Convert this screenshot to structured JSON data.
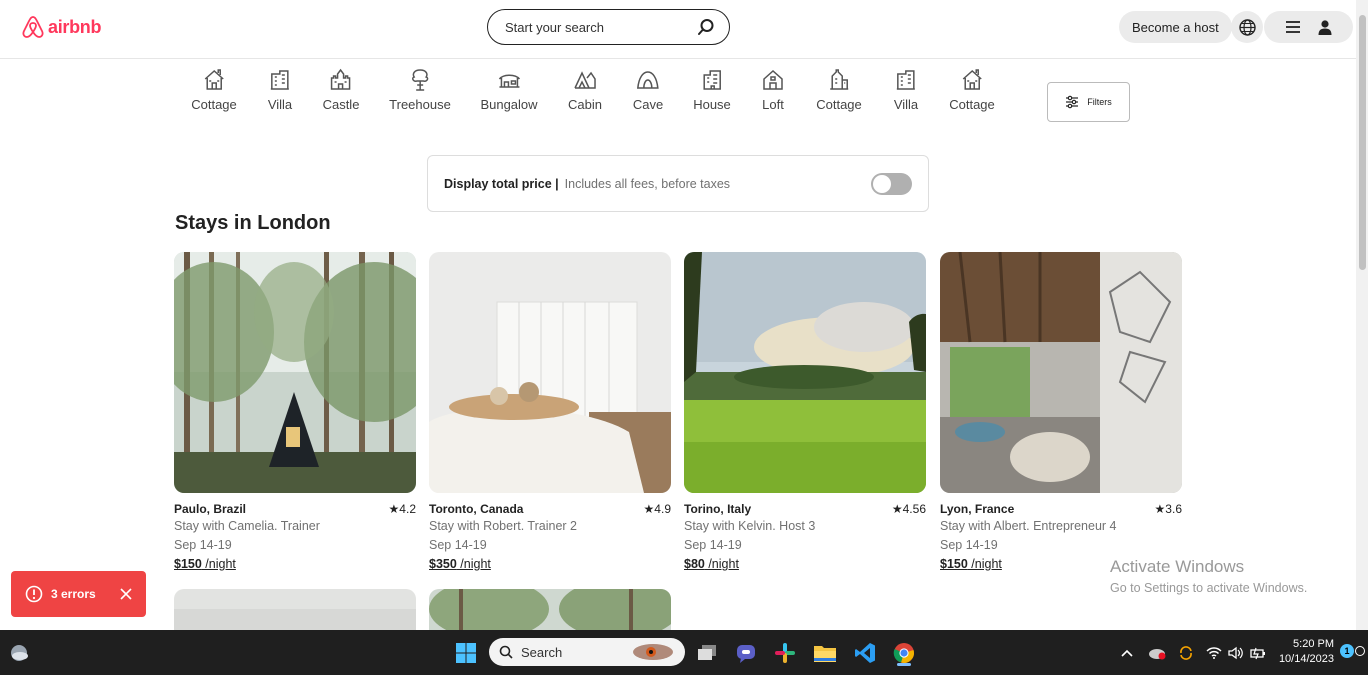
{
  "header": {
    "logo_text": "airbnb",
    "search_placeholder": "Start your search",
    "host_label": "Become a host"
  },
  "categories": [
    {
      "label": "Cottage",
      "icon": "cottage-icon"
    },
    {
      "label": "Villa",
      "icon": "villa-icon"
    },
    {
      "label": "Castle",
      "icon": "castle-icon"
    },
    {
      "label": "Treehouse",
      "icon": "treehouse-icon"
    },
    {
      "label": "Bungalow",
      "icon": "bungalow-icon"
    },
    {
      "label": "Cabin",
      "icon": "cabin-icon"
    },
    {
      "label": "Cave",
      "icon": "cave-icon"
    },
    {
      "label": "House",
      "icon": "house-icon"
    },
    {
      "label": "Loft",
      "icon": "loft-icon"
    },
    {
      "label": "Cottage",
      "icon": "cottage-icon"
    },
    {
      "label": "Villa",
      "icon": "villa-icon"
    },
    {
      "label": "Cottage",
      "icon": "cottage-icon"
    }
  ],
  "filters_label": "Filters",
  "price_toggle": {
    "label": "Display total price |",
    "sub": "Includes all fees, before taxes",
    "on": false
  },
  "section_title": "Stays in London",
  "listings": [
    {
      "location": "Paulo, Brazil",
      "rating": "★4.2",
      "host": "Stay with Camelia. Trainer",
      "dates": "Sep 14-19",
      "price": "$150",
      "per": " /night"
    },
    {
      "location": "Toronto, Canada",
      "rating": "★4.9",
      "host": "Stay with Robert. Trainer 2",
      "dates": "Sep 14-19",
      "price": "$350",
      "per": " /night"
    },
    {
      "location": "Torino, Italy",
      "rating": "★4.56",
      "host": "Stay with Kelvin. Host 3",
      "dates": "Sep 14-19",
      "price": "$80",
      "per": " /night"
    },
    {
      "location": "Lyon, France",
      "rating": "★3.6",
      "host": "Stay with Albert. Entrepreneur 4",
      "dates": "Sep 14-19",
      "price": "$150",
      "per": " /night"
    }
  ],
  "errors_label": "3 errors",
  "activate_windows": {
    "title": "Activate Windows",
    "sub": "Go to Settings to activate Windows."
  },
  "taskbar": {
    "search_label": "Search",
    "time": "5:20 PM",
    "date": "10/14/2023",
    "notification_count": "1"
  },
  "colors": {
    "brand": "#ff385c",
    "error": "#ef4444",
    "taskbar": "#1f1f1f"
  }
}
